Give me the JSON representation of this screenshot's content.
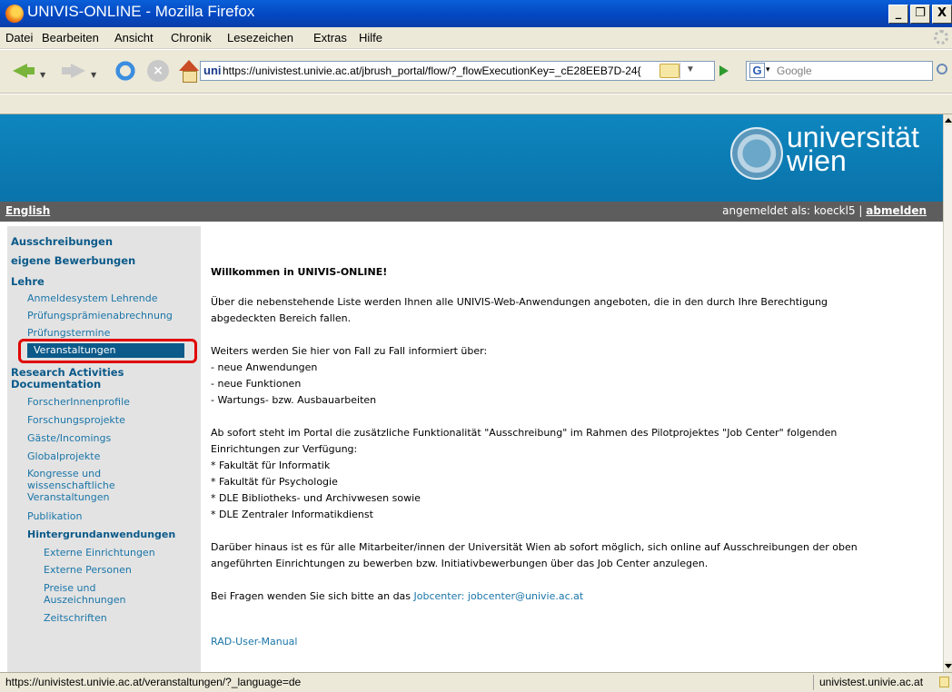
{
  "window": {
    "title": "UNIVIS-ONLINE - Mozilla Firefox",
    "buttons": [
      "_",
      "❐",
      "X"
    ]
  },
  "menubar": [
    "Datei",
    "Bearbeiten",
    "Ansicht",
    "Chronik",
    "Lesezeichen",
    "Extras",
    "Hilfe"
  ],
  "navbar": {
    "url": "https://univistest.univie.ac.at/jbrush_portal/flow/?_flowExecutionKey=_cE28EEB7D-24{",
    "url_favicon": "uni",
    "search_engine_icon": "G",
    "search_placeholder": "Google"
  },
  "banner": {
    "logo_line1": "universität",
    "logo_line2": "wien"
  },
  "strip": {
    "language_link": "English",
    "logged_in_prefix": "angemeldet als: koeckl5 | ",
    "logout_link": "abmelden"
  },
  "sidebar": {
    "items": [
      {
        "label": "Ausschreibungen"
      },
      {
        "label": "eigene Bewerbungen"
      },
      {
        "label": "Lehre"
      },
      {
        "label": "Anmeldesystem Lehrende"
      },
      {
        "label": "Prüfungsprämienabrechnung"
      },
      {
        "label": "Prüfungstermine"
      },
      {
        "label": "Veranstaltungen"
      },
      {
        "label": "Research Activities"
      },
      {
        "label": "Documentation"
      },
      {
        "label": "ForscherInnenprofile"
      },
      {
        "label": "Forschungsprojekte"
      },
      {
        "label": "Gäste/Incomings"
      },
      {
        "label": "Globalprojekte"
      },
      {
        "label": "Kongresse und"
      },
      {
        "label": "wissenschaftliche"
      },
      {
        "label": "Veranstaltungen"
      },
      {
        "label": "Publikation"
      },
      {
        "label": "Hintergrundanwendungen"
      },
      {
        "label": "Externe Einrichtungen"
      },
      {
        "label": "Externe Personen"
      },
      {
        "label": "Preise und"
      },
      {
        "label": "Auszeichnungen"
      },
      {
        "label": "Zeitschriften"
      }
    ]
  },
  "main": {
    "welcome": "Willkommen in UNIVIS-ONLINE!",
    "p1_line1": "Über die nebenstehende Liste werden Ihnen alle UNIVIS-Web-Anwendungen angeboten, die in den durch Ihre Berechtigung",
    "p1_line2": "abgedeckten Bereich fallen.",
    "p2_intro": "Weiters werden Sie hier von Fall zu Fall informiert über:",
    "p2_items": [
      "- neue Anwendungen",
      "- neue Funktionen",
      "- Wartungs- bzw. Ausbauarbeiten"
    ],
    "p3_line1": "Ab sofort steht im Portal die zusätzliche Funktionalität \"Ausschreibung\" im Rahmen des Pilotprojektes \"Job Center\" folgenden",
    "p3_line2": "Einrichtungen zur Verfügung:",
    "p3_items": [
      "* Fakultät für Informatik",
      "* Fakultät für Psychologie",
      "* DLE Bibliotheks- und Archivwesen sowie",
      "* DLE Zentraler Informatikdienst"
    ],
    "p4_line1": "Darüber hinaus ist es für alle Mitarbeiter/innen der Universität Wien ab sofort möglich, sich online auf Ausschreibungen der oben",
    "p4_line2": "angeführten Einrichtungen zu bewerben bzw. Initiativbewerbungen über das Job Center anzulegen.",
    "p5_text": "Bei Fragen wenden Sie sich bitte an das ",
    "p5_link": "Jobcenter: jobcenter@univie.ac.at",
    "manual_link": "RAD-User-Manual"
  },
  "statusbar": {
    "text": "https://univistest.univie.ac.at/veranstaltungen/?_language=de",
    "host": "univistest.univie.ac.at"
  }
}
